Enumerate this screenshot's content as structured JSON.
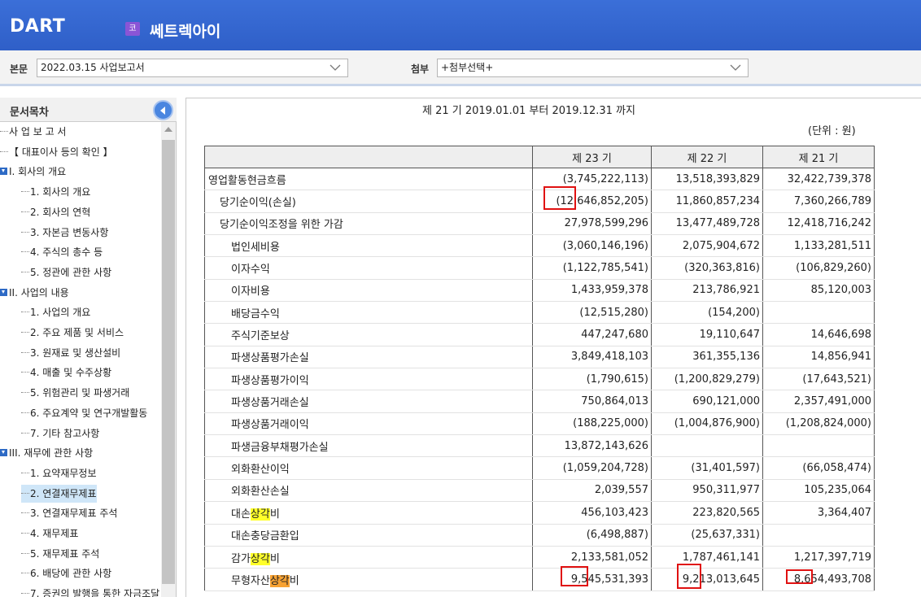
{
  "header": {
    "logo_text": "DART",
    "company_badge": "코",
    "company_name": "쎄트렉아이"
  },
  "selectors": {
    "report_label": "본문",
    "report_value": "2022.03.15  사업보고서",
    "attach_label": "첨부",
    "attach_value": "+첨부선택+"
  },
  "sidebar": {
    "title": "문서목차",
    "items": [
      {
        "label": "사 업 보 고 서",
        "level": 0,
        "toggle": false,
        "selected": false
      },
      {
        "label": "【 대표이사 등의 확인 】",
        "level": 0,
        "toggle": false,
        "selected": false
      },
      {
        "label": "I. 회사의 개요",
        "level": 0,
        "toggle": true,
        "selected": false
      },
      {
        "label": "1. 회사의 개요",
        "level": 1,
        "toggle": false,
        "selected": false
      },
      {
        "label": "2. 회사의 연혁",
        "level": 1,
        "toggle": false,
        "selected": false
      },
      {
        "label": "3. 자본금 변동사항",
        "level": 1,
        "toggle": false,
        "selected": false
      },
      {
        "label": "4. 주식의 총수 등",
        "level": 1,
        "toggle": false,
        "selected": false
      },
      {
        "label": "5. 정관에 관한 사항",
        "level": 1,
        "toggle": false,
        "selected": false
      },
      {
        "label": "II. 사업의 내용",
        "level": 0,
        "toggle": true,
        "selected": false
      },
      {
        "label": "1. 사업의 개요",
        "level": 1,
        "toggle": false,
        "selected": false
      },
      {
        "label": "2. 주요 제품 및 서비스",
        "level": 1,
        "toggle": false,
        "selected": false
      },
      {
        "label": "3. 원재료 및 생산설비",
        "level": 1,
        "toggle": false,
        "selected": false
      },
      {
        "label": "4. 매출 및 수주상황",
        "level": 1,
        "toggle": false,
        "selected": false
      },
      {
        "label": "5. 위험관리 및 파생거래",
        "level": 1,
        "toggle": false,
        "selected": false
      },
      {
        "label": "6. 주요계약 및 연구개발활동",
        "level": 1,
        "toggle": false,
        "selected": false
      },
      {
        "label": "7. 기타 참고사항",
        "level": 1,
        "toggle": false,
        "selected": false
      },
      {
        "label": "III. 재무에 관한 사항",
        "level": 0,
        "toggle": true,
        "selected": false
      },
      {
        "label": "1. 요약재무정보",
        "level": 1,
        "toggle": false,
        "selected": false
      },
      {
        "label": "2. 연결재무제표",
        "level": 1,
        "toggle": false,
        "selected": true
      },
      {
        "label": "3. 연결재무제표 주석",
        "level": 1,
        "toggle": false,
        "selected": false
      },
      {
        "label": "4. 재무제표",
        "level": 1,
        "toggle": false,
        "selected": false
      },
      {
        "label": "5. 재무제표 주석",
        "level": 1,
        "toggle": false,
        "selected": false
      },
      {
        "label": "6. 배당에 관한 사항",
        "level": 1,
        "toggle": false,
        "selected": false
      },
      {
        "label": "7. 증권의 발행을 통한 자금조달",
        "level": 1,
        "toggle": false,
        "selected": false
      }
    ]
  },
  "main": {
    "period": "제 21 기 2019.01.01 부터 2019.12.31 까지",
    "unit": "(단위 : 원)",
    "columns": [
      "",
      "제 23 기",
      "제 22 기",
      "제 21 기"
    ],
    "rows": [
      {
        "label": "영업활동현금흐름",
        "indent": 0,
        "values": [
          "(3,745,222,113)",
          "13,518,393,829",
          "32,422,739,378"
        ]
      },
      {
        "label": "당기순이익(손실)",
        "indent": 1,
        "values": [
          "(12,646,852,205)",
          "11,860,857,234",
          "7,360,266,789"
        ]
      },
      {
        "label": "당기순이익조정을 위한 가감",
        "indent": 1,
        "values": [
          "27,978,599,296",
          "13,477,489,728",
          "12,418,716,242"
        ]
      },
      {
        "label": "법인세비용",
        "indent": 2,
        "values": [
          "(3,060,146,196)",
          "2,075,904,672",
          "1,133,281,511"
        ]
      },
      {
        "label": "이자수익",
        "indent": 2,
        "values": [
          "(1,122,785,541)",
          "(320,363,816)",
          "(106,829,260)"
        ]
      },
      {
        "label": "이자비용",
        "indent": 2,
        "values": [
          "1,433,959,378",
          "213,786,921",
          "85,120,003"
        ]
      },
      {
        "label": "배당금수익",
        "indent": 2,
        "values": [
          "(12,515,280)",
          "(154,200)",
          ""
        ]
      },
      {
        "label": "주식기준보상",
        "indent": 2,
        "values": [
          "447,247,680",
          "19,110,647",
          "14,646,698"
        ]
      },
      {
        "label": "파생상품평가손실",
        "indent": 2,
        "values": [
          "3,849,418,103",
          "361,355,136",
          "14,856,941"
        ]
      },
      {
        "label": "파생상품평가이익",
        "indent": 2,
        "values": [
          "(1,790,615)",
          "(1,200,829,279)",
          "(17,643,521)"
        ]
      },
      {
        "label": "파생상품거래손실",
        "indent": 2,
        "values": [
          "750,864,013",
          "690,121,000",
          "2,357,491,000"
        ]
      },
      {
        "label": "파생상품거래이익",
        "indent": 2,
        "values": [
          "(188,225,000)",
          "(1,004,876,900)",
          "(1,208,824,000)"
        ]
      },
      {
        "label": "파생금융부채평가손실",
        "indent": 2,
        "values": [
          "13,872,143,626",
          "",
          ""
        ]
      },
      {
        "label": "외화환산이익",
        "indent": 2,
        "values": [
          "(1,059,204,728)",
          "(31,401,597)",
          "(66,058,474)"
        ]
      },
      {
        "label": "외화환산손실",
        "indent": 2,
        "values": [
          "2,039,557",
          "950,311,977",
          "105,235,064"
        ]
      },
      {
        "label": "대손상각비",
        "indent": 2,
        "values": [
          "456,103,423",
          "223,820,565",
          "3,364,407"
        ]
      },
      {
        "label": "대손충당금환입",
        "indent": 2,
        "values": [
          "(6,498,887)",
          "(25,637,331)",
          ""
        ]
      },
      {
        "label": "감가상각비",
        "indent": 2,
        "values": [
          "2,133,581,052",
          "1,787,461,141",
          "1,217,397,719"
        ]
      },
      {
        "label": "무형자산상각비",
        "indent": 2,
        "values": [
          "9,545,531,393",
          "9,213,013,645",
          "8,654,493,708"
        ]
      }
    ]
  },
  "colors": {
    "header_blue": "#2f5fc8",
    "highlight_yellow": "#ffff2a",
    "highlight_orange": "#f7a233",
    "annotation_red": "#e01111",
    "selected_item": "#cfe6f8"
  }
}
